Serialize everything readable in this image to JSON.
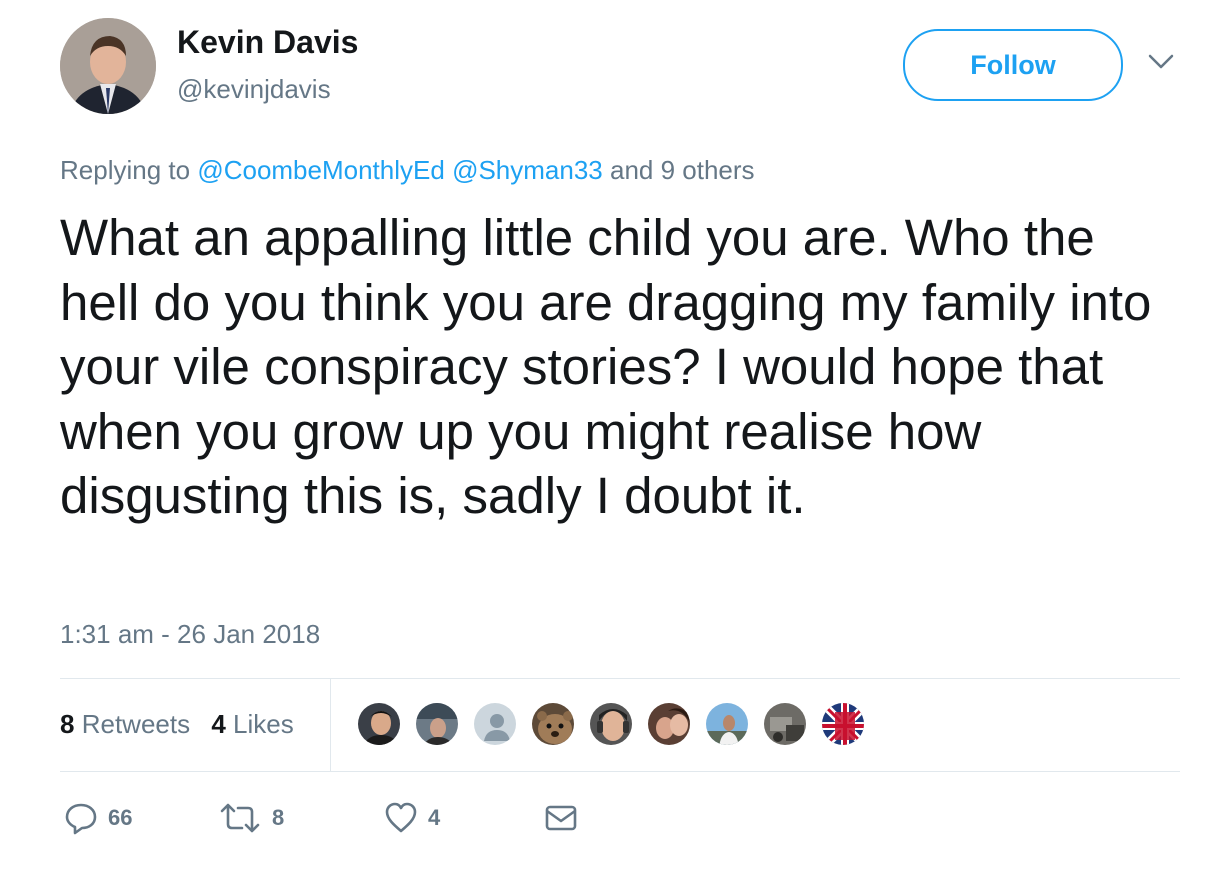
{
  "user": {
    "name": "Kevin Davis",
    "handle": "@kevinjdavis"
  },
  "follow_label": "Follow",
  "reply": {
    "prefix": "Replying to",
    "mentions": [
      "@CoombeMonthlyEd",
      "@Shyman33"
    ],
    "suffix": "and 9 others"
  },
  "tweet": {
    "text": "What an appalling little child you are. Who the hell do you think you are dragging my family into your vile conspiracy stories? I would hope that when you grow up you might realise how disgusting this is, sadly I doubt it.",
    "timestamp": "1:31 am - 26 Jan 2018"
  },
  "stats": {
    "retweets_count": "8",
    "retweets_label": "Retweets",
    "likes_count": "4",
    "likes_label": "Likes"
  },
  "actions": {
    "reply_count": "66",
    "retweet_count": "8",
    "like_count": "4"
  },
  "icons": {
    "reply": "speech-bubble-icon",
    "retweet": "retweet-arrows-icon",
    "like": "heart-icon",
    "message": "envelope-icon",
    "more": "chevron-down-icon"
  },
  "colors": {
    "accent": "#1da1f2",
    "text": "#14171a",
    "secondary_text": "#657786",
    "divider": "#e1e8ed"
  }
}
